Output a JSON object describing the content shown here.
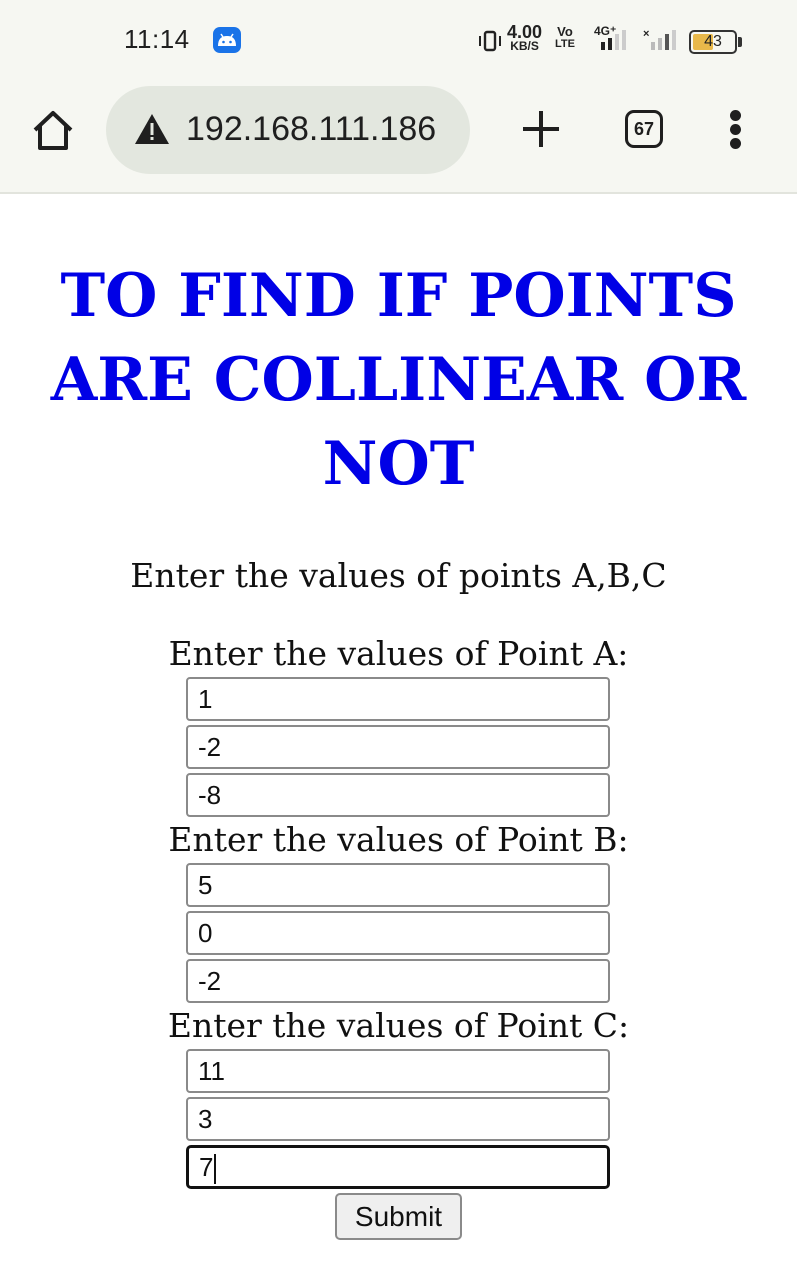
{
  "status_bar": {
    "time": "11:14",
    "speed_value": "4.00",
    "speed_unit": "KB/S",
    "volte_top": "Vo",
    "volte_bottom": "LTE",
    "network": "4G⁺",
    "battery": "43"
  },
  "browser": {
    "url": "192.168.111.186",
    "tab_count": "67"
  },
  "page": {
    "title": "TO FIND IF POINTS ARE COLLINEAR OR NOT",
    "intro": "Enter the values of points A,B,C",
    "point_a": {
      "label": "Enter the values of Point A:",
      "values": [
        "1",
        "-2",
        "-8"
      ]
    },
    "point_b": {
      "label": "Enter the values of Point B:",
      "values": [
        "5",
        "0",
        "-2"
      ]
    },
    "point_c": {
      "label": "Enter the values of Point C:",
      "values": [
        "11",
        "3",
        "7"
      ]
    },
    "submit_label": "Submit"
  },
  "colors": {
    "title": "#0000e6",
    "chrome_bg": "#f6f7f2",
    "omnibox_bg": "#e3e7df"
  }
}
